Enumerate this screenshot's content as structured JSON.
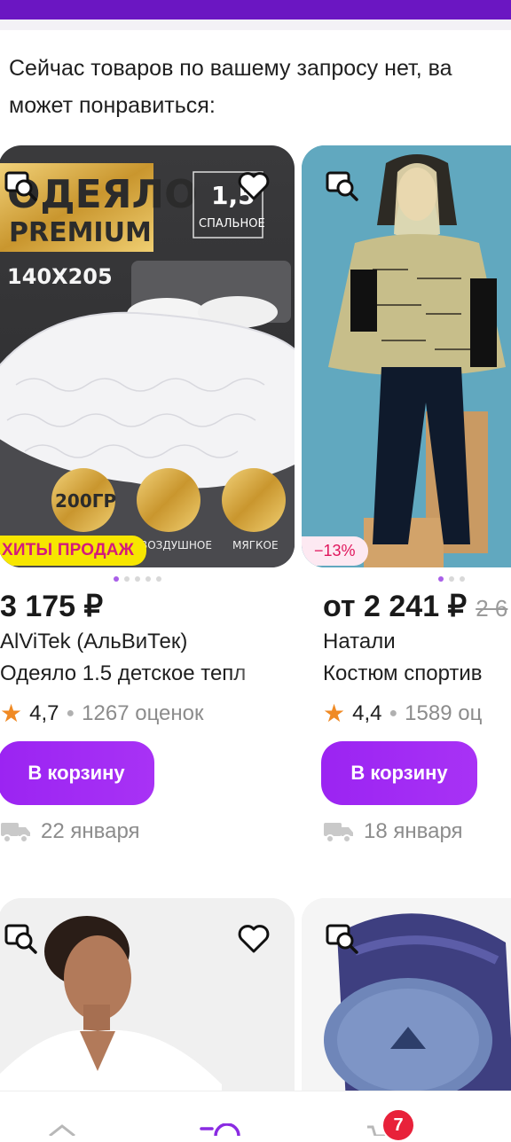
{
  "header": {
    "color": "#6b16c2"
  },
  "notice": {
    "line1": "Сейчас товаров по вашему запросу нет, ва",
    "line2": "может понравиться:"
  },
  "products": [
    {
      "badge": "ХИТЫ ПРОДАЖ",
      "image_texts": {
        "title1": "ОДЕЯЛО",
        "title2": "PREMIUM",
        "size": "140X205",
        "corner_num": "1,5",
        "corner_label": "СПАЛЬНОЕ",
        "circle1": "200ГР",
        "circle2": "ВОЗДУШНОЕ",
        "circle3": "МЯГКОЕ"
      },
      "price": "3 175 ₽",
      "old_price": "",
      "brand": "AlViTek (АльВиТек)",
      "name": "Одеяло 1.5 детское тепл",
      "rating": "4,7",
      "reviews": "1267 оценок",
      "button": "В корзину",
      "delivery": "22 января"
    },
    {
      "badge": "−13%",
      "price": "от 2 241 ₽",
      "old_price": "2 6",
      "brand": "Натали",
      "name": "Костюм спортив",
      "rating": "4,4",
      "reviews": "1589 оц",
      "button": "В корзину",
      "delivery": "18 января"
    }
  ],
  "cart": {
    "count": "7"
  },
  "colors": {
    "accent": "#a020f0",
    "star": "#f08a24",
    "badge_hit_bg": "#f7e600",
    "badge_hit_text": "#d41a7b",
    "discount": "#e0165c"
  }
}
